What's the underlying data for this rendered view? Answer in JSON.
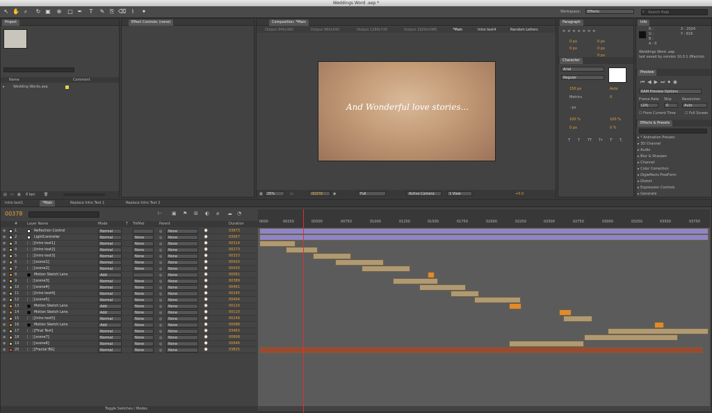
{
  "window": {
    "title": "Weddings Word .aep *"
  },
  "toolbar": {
    "workspace_label": "Workspace:",
    "workspace_value": "Effects",
    "search_placeholder": "Search Help"
  },
  "project": {
    "tab": "Project",
    "columns": [
      "Name",
      "Comment"
    ],
    "items": [
      {
        "name": "Wedding Words.aep"
      }
    ],
    "bpc": "8 bpc"
  },
  "effect_controls": {
    "tab": "Effect Controls: (none)"
  },
  "composition": {
    "tab": "Composition: *Main",
    "outputs": [
      "Output 640x360",
      "Output 960x540",
      "Output 1280x720",
      "Output 1920x1080",
      "*Main",
      "Intro text4",
      "Random Letters"
    ],
    "text": "And Wonderful love stories...",
    "footer": {
      "zoom": "25%",
      "timecode": "00378",
      "resolution": "Full",
      "camera": "Active Camera",
      "view": "1 View",
      "exposure": "+0.0"
    }
  },
  "paragraph": {
    "tab": "Paragraph",
    "values": [
      "0 px",
      "0 px",
      "0 px",
      "0 px",
      "0 px"
    ]
  },
  "character": {
    "tab": "Character",
    "font": "Arial",
    "style": "Regular",
    "size": "150 px",
    "leading": "Auto",
    "kerning": "Metrics",
    "tracking": "0",
    "stroke": "- px",
    "vscale": "100 %",
    "hscale": "100 %",
    "baseline": "0 px",
    "tsume": "0 %",
    "styles": [
      "T",
      "T",
      "TT",
      "Tт",
      "T'",
      "T,"
    ]
  },
  "info": {
    "tab": "Info",
    "r": "R :",
    "g": "G :",
    "b": "B :",
    "a": "A : 0",
    "x": "X : 2024",
    "y": "Y : 816",
    "file": "Weddings Word .aep",
    "saved": "last saved by version 10.0.1 (Macinto"
  },
  "preview": {
    "tab": "Preview",
    "option": "RAM Preview Options",
    "frame_rate_label": "Frame Rate",
    "skip_label": "Skip",
    "resolution_label": "Resolution",
    "frame_rate": "(24)",
    "skip": "0",
    "resolution": "Auto",
    "from_current": "From Current Time",
    "full_screen": "Full Screen"
  },
  "effects": {
    "tab": "Effects & Presets",
    "search_placeholder": "",
    "items": [
      "* Animation Presets",
      "3D Channel",
      "Audio",
      "Blur & Sharpen",
      "Channel",
      "Color Correction",
      "Digieffects FreeForm",
      "Distort",
      "Expression Controls",
      "Generate"
    ]
  },
  "timeline": {
    "tabs": [
      "Intro text1",
      "*Main",
      "Replace Intro Text 1",
      "Replace Intro Text 2"
    ],
    "timecode": "00378",
    "columns": [
      "#",
      "Layer Name",
      "Mode",
      "T",
      "TrkMat",
      "Parent",
      "Duration"
    ],
    "toggle_label": "Toggle Switches / Modes",
    "ruler": [
      "0000",
      "00250",
      "00500",
      "00750",
      "01000",
      "01250",
      "01500",
      "01750",
      "02000",
      "02250",
      "02500",
      "02750",
      "03000",
      "03250",
      "03500",
      "03750"
    ],
    "layers": [
      {
        "num": "1",
        "name": "Reflection Control",
        "mode": "Normal",
        "trkmat": "",
        "parent": "None",
        "duration": "03873",
        "label": "#d8d8d8",
        "solid": "#ffffff"
      },
      {
        "num": "2",
        "name": "LightController",
        "mode": "Normal",
        "trkmat": "None",
        "parent": "None",
        "duration": "03957",
        "label": "#d8d8d8",
        "solid": "#ffffff"
      },
      {
        "num": "3",
        "name": "[Intro text1]",
        "mode": "Normal",
        "trkmat": "None",
        "parent": "None",
        "duration": "00314",
        "label": "#c9b48a",
        "solid": ""
      },
      {
        "num": "4",
        "name": "[Intro text2]",
        "mode": "Normal",
        "trkmat": "None",
        "parent": "None",
        "duration": "00273",
        "label": "#c9b48a",
        "solid": ""
      },
      {
        "num": "5",
        "name": "[Intro text3]",
        "mode": "Normal",
        "trkmat": "None",
        "parent": "None",
        "duration": "00333",
        "label": "#c9b48a",
        "solid": ""
      },
      {
        "num": "6",
        "name": "[scene1]",
        "mode": "Normal",
        "trkmat": "None",
        "parent": "None",
        "duration": "00420",
        "label": "#c9b48a",
        "solid": ""
      },
      {
        "num": "7",
        "name": "[scene2]",
        "mode": "Normal",
        "trkmat": "None",
        "parent": "None",
        "duration": "00420",
        "label": "#c9b48a",
        "solid": ""
      },
      {
        "num": "8",
        "name": "Motion Sketch Lens",
        "mode": "Add",
        "trkmat": "",
        "parent": "None",
        "duration": "00061",
        "label": "#e08b2a",
        "solid": "#000000"
      },
      {
        "num": "9",
        "name": "[scene3]",
        "mode": "Normal",
        "trkmat": "None",
        "parent": "None",
        "duration": "00389",
        "label": "#c9b48a",
        "solid": ""
      },
      {
        "num": "10",
        "name": "[scene4]",
        "mode": "Normal",
        "trkmat": "None",
        "parent": "None",
        "duration": "00401",
        "label": "#c9b48a",
        "solid": ""
      },
      {
        "num": "11",
        "name": "[Intro text4]",
        "mode": "Normal",
        "trkmat": "None",
        "parent": "None",
        "duration": "00245",
        "label": "#c9b48a",
        "solid": ""
      },
      {
        "num": "12",
        "name": "[scene5]",
        "mode": "Normal",
        "trkmat": "None",
        "parent": "None",
        "duration": "00404",
        "label": "#c9b48a",
        "solid": ""
      },
      {
        "num": "13",
        "name": "Motion Sketch Lens",
        "mode": "Add",
        "trkmat": "None",
        "parent": "None",
        "duration": "00110",
        "label": "#e08b2a",
        "solid": "#000000"
      },
      {
        "num": "14",
        "name": "Motion Sketch Lens",
        "mode": "Add",
        "trkmat": "None",
        "parent": "None",
        "duration": "00110",
        "label": "#e08b2a",
        "solid": "#000000"
      },
      {
        "num": "15",
        "name": "[Intro text5]",
        "mode": "Normal",
        "trkmat": "None",
        "parent": "None",
        "duration": "00249",
        "label": "#c9b48a",
        "solid": ""
      },
      {
        "num": "16",
        "name": "Motion Sketch Lens",
        "mode": "Add",
        "trkmat": "None",
        "parent": "None",
        "duration": "00088",
        "label": "#e08b2a",
        "solid": "#000000"
      },
      {
        "num": "17",
        "name": "[Final Text]",
        "mode": "Normal",
        "trkmat": "None",
        "parent": "None",
        "duration": "03463",
        "label": "#c9b48a",
        "solid": ""
      },
      {
        "num": "18",
        "name": "[scene7]",
        "mode": "Normal",
        "trkmat": "None",
        "parent": "None",
        "duration": "00808",
        "label": "#c9b48a",
        "solid": ""
      },
      {
        "num": "19",
        "name": "[scene6]",
        "mode": "Normal",
        "trkmat": "None",
        "parent": "None",
        "duration": "00646",
        "label": "#c9b48a",
        "solid": ""
      },
      {
        "num": "20",
        "name": "[Fractal BG]",
        "mode": "Normal",
        "trkmat": "None",
        "parent": "None",
        "duration": "03825",
        "label": "#c75a35",
        "solid": ""
      }
    ],
    "bars": [
      {
        "start": 0,
        "end": 3873,
        "kind": "purple"
      },
      {
        "start": 0,
        "end": 3957,
        "kind": "purple"
      },
      {
        "start": 0,
        "end": 314,
        "kind": "tan"
      },
      {
        "start": 230,
        "end": 503,
        "kind": "tan"
      },
      {
        "start": 460,
        "end": 793,
        "kind": "tan"
      },
      {
        "start": 650,
        "end": 1070,
        "kind": "tan"
      },
      {
        "start": 880,
        "end": 1300,
        "kind": "tan"
      },
      {
        "start": 1450,
        "end": 1511,
        "kind": "orange"
      },
      {
        "start": 1150,
        "end": 1539,
        "kind": "tan"
      },
      {
        "start": 1380,
        "end": 1781,
        "kind": "tan"
      },
      {
        "start": 1650,
        "end": 1895,
        "kind": "tan"
      },
      {
        "start": 1850,
        "end": 2254,
        "kind": "tan"
      },
      {
        "start": 2150,
        "end": 2260,
        "kind": "orange"
      },
      {
        "start": 2580,
        "end": 2690,
        "kind": "orange"
      },
      {
        "start": 2620,
        "end": 2869,
        "kind": "tan"
      },
      {
        "start": 3400,
        "end": 3488,
        "kind": "orange"
      },
      {
        "start": 3000,
        "end": 6463,
        "kind": "tan"
      },
      {
        "start": 2800,
        "end": 3608,
        "kind": "tan"
      },
      {
        "start": 2150,
        "end": 2796,
        "kind": "tan"
      },
      {
        "start": 0,
        "end": 3825,
        "kind": "red"
      }
    ],
    "visible_end": 3870,
    "playhead": 378
  },
  "colors": {
    "accent": "#e8a33c",
    "purple": "#8e85c6",
    "tan": "#b09a73",
    "orange": "#e08b2a",
    "red": "#9a4a2f"
  }
}
